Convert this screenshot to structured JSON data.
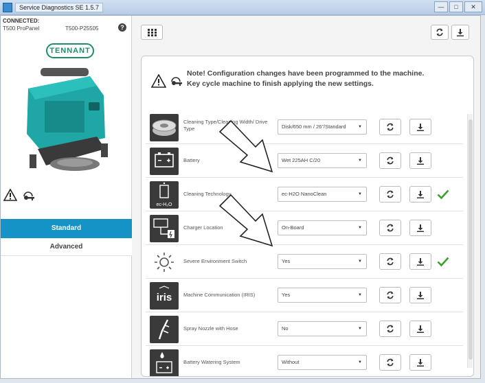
{
  "window": {
    "title": "Service Diagnostics SE 1.5.7"
  },
  "sidebar": {
    "connection_label": "CONNECTED:",
    "model": "T500 ProPanel",
    "serial": "T500-P25505",
    "logo_text": "TENNANT",
    "nav": [
      {
        "label": "Standard",
        "active": true
      },
      {
        "label": "Advanced",
        "active": false
      }
    ]
  },
  "note": {
    "line1": "Note! Configuration changes have been programmed to the machine.",
    "line2": "Key cycle machine to finish applying the new settings."
  },
  "settings": [
    {
      "label": "Cleaning Type/Cleaning Width/ Drive Type",
      "value": "Disk/650 mm / 26\"/Standard",
      "icon": "disc-brush-icon",
      "applied": false
    },
    {
      "label": "Battery",
      "value": "Wet 225AH C/20",
      "icon": "battery-icon",
      "applied": false
    },
    {
      "label": "Cleaning Technology",
      "value": "ec-H2O NanoClean",
      "icon": "ec-h2o-icon",
      "icon_text": "ec-H₂O",
      "applied": true
    },
    {
      "label": "Charger Location",
      "value": "On-Board",
      "icon": "charger-icon",
      "applied": false
    },
    {
      "label": "Severe Environment Switch",
      "value": "Yes",
      "icon": "severe-environment-icon",
      "applied": true
    },
    {
      "label": "Machine Communication (IRIS)",
      "value": "Yes",
      "icon": "iris-logo-icon",
      "icon_text": "iris",
      "applied": false
    },
    {
      "label": "Spray Nozzle with Hose",
      "value": "No",
      "icon": "spray-nozzle-icon",
      "applied": false
    },
    {
      "label": "Battery Watering System",
      "value": "Without",
      "icon": "battery-watering-icon",
      "applied": false
    }
  ],
  "colors": {
    "accent": "#1593c6",
    "brand": "#1b8f6b",
    "check": "#3aa02c",
    "icon_bg": "#3a3a3a"
  }
}
